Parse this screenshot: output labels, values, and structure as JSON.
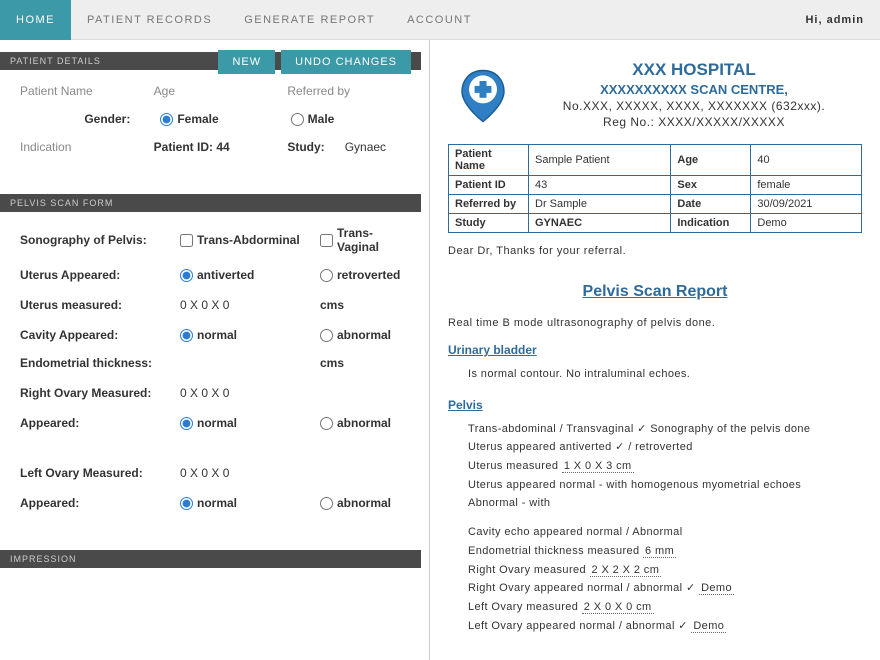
{
  "greeting": "Hi, admin",
  "nav": {
    "home": "HOME",
    "records": "PATIENT RECORDS",
    "report": "GENERATE REPORT",
    "account": "ACCOUNT"
  },
  "buttons": {
    "new": "NEW",
    "undo": "UNDO CHANGES"
  },
  "sections": {
    "patient": "PATIENT DETAILS",
    "pelvis": "PELVIS SCAN FORM",
    "impression": "IMPRESSION"
  },
  "form": {
    "patient_name_lbl": "Patient Name",
    "age_lbl": "Age",
    "referred_lbl": "Referred by",
    "gender_lbl": "Gender:",
    "female": "Female",
    "male": "Male",
    "indication_lbl": "Indication",
    "patient_id_lbl": "Patient ID: 44",
    "study_lbl": "Study:",
    "study_val": "Gynaec",
    "sono_lbl": "Sonography of Pelvis:",
    "transabd": "Trans-Abdorminal",
    "transvag": "Trans-Vaginal",
    "uterus_app_lbl": "Uterus Appeared:",
    "antiverted": "antiverted",
    "retroverted": "retroverted",
    "uterus_meas_lbl": "Uterus measured:",
    "zeros": "0 X 0 X 0",
    "cms": "cms",
    "cavity_lbl": "Cavity Appeared:",
    "normal": "normal",
    "abnormal": "abnormal",
    "endo_lbl": "Endometrial thickness:",
    "rov_lbl": "Right Ovary Measured:",
    "app_lbl": "Appeared:",
    "lov_lbl": "Left Ovary Measured:"
  },
  "report": {
    "hospital": "XXX HOSPITAL",
    "centre": "XXXXXXXXXX SCAN CENTRE,",
    "addr": "No.XXX, XXXXX, XXXX, XXXXXXX (632xxx).",
    "reg": "Reg No.: XXXX/XXXXX/XXXXX",
    "pname_lbl": "Patient Name",
    "pname": "Sample Patient",
    "age_lbl": "Age",
    "age": "40",
    "pid_lbl": "Patient ID",
    "pid": "43",
    "sex_lbl": "Sex",
    "sex": "female",
    "ref_lbl": "Referred by",
    "ref": "Dr Sample",
    "date_lbl": "Date",
    "date": "30/09/2021",
    "study_lbl": "Study",
    "study": "GYNAEC",
    "ind_lbl": "Indication",
    "ind": "Demo",
    "dear": "Dear Dr, Thanks for your referral.",
    "title": "Pelvis Scan Report",
    "realtime": "Real time B mode ultrasonography of pelvis done.",
    "ub_hdr": "Urinary bladder",
    "ub_txt": "Is normal contour. No intraluminal echoes.",
    "pelvis_hdr": "Pelvis",
    "p1": "Trans-abdominal / Transvaginal ✓ Sonography of the pelvis done",
    "p2a": "Uterus appeared antiverted ✓ / retroverted",
    "p2b": "Uterus measured ",
    "p2c": "1 X 0 X 3 cm",
    "p3": "Uterus appeared normal - with homogenous myometrial echoes",
    "p4": "Abnormal - with",
    "p5": "Cavity echo appeared normal / Abnormal",
    "p6a": "Endometrial thickness measured ",
    "p6b": "6 mm",
    "p7a": "Right Ovary measured ",
    "p7b": "2 X 2 X 2 cm",
    "p8a": "Right Ovary appeared normal / abnormal ✓ ",
    "p8b": "Demo",
    "p9a": "Left Ovary measured ",
    "p9b": "2 X 0 X 0 cm",
    "p10": "Left Ovary appeared normal / abnormal ✓ ",
    "p10b": "Demo"
  }
}
